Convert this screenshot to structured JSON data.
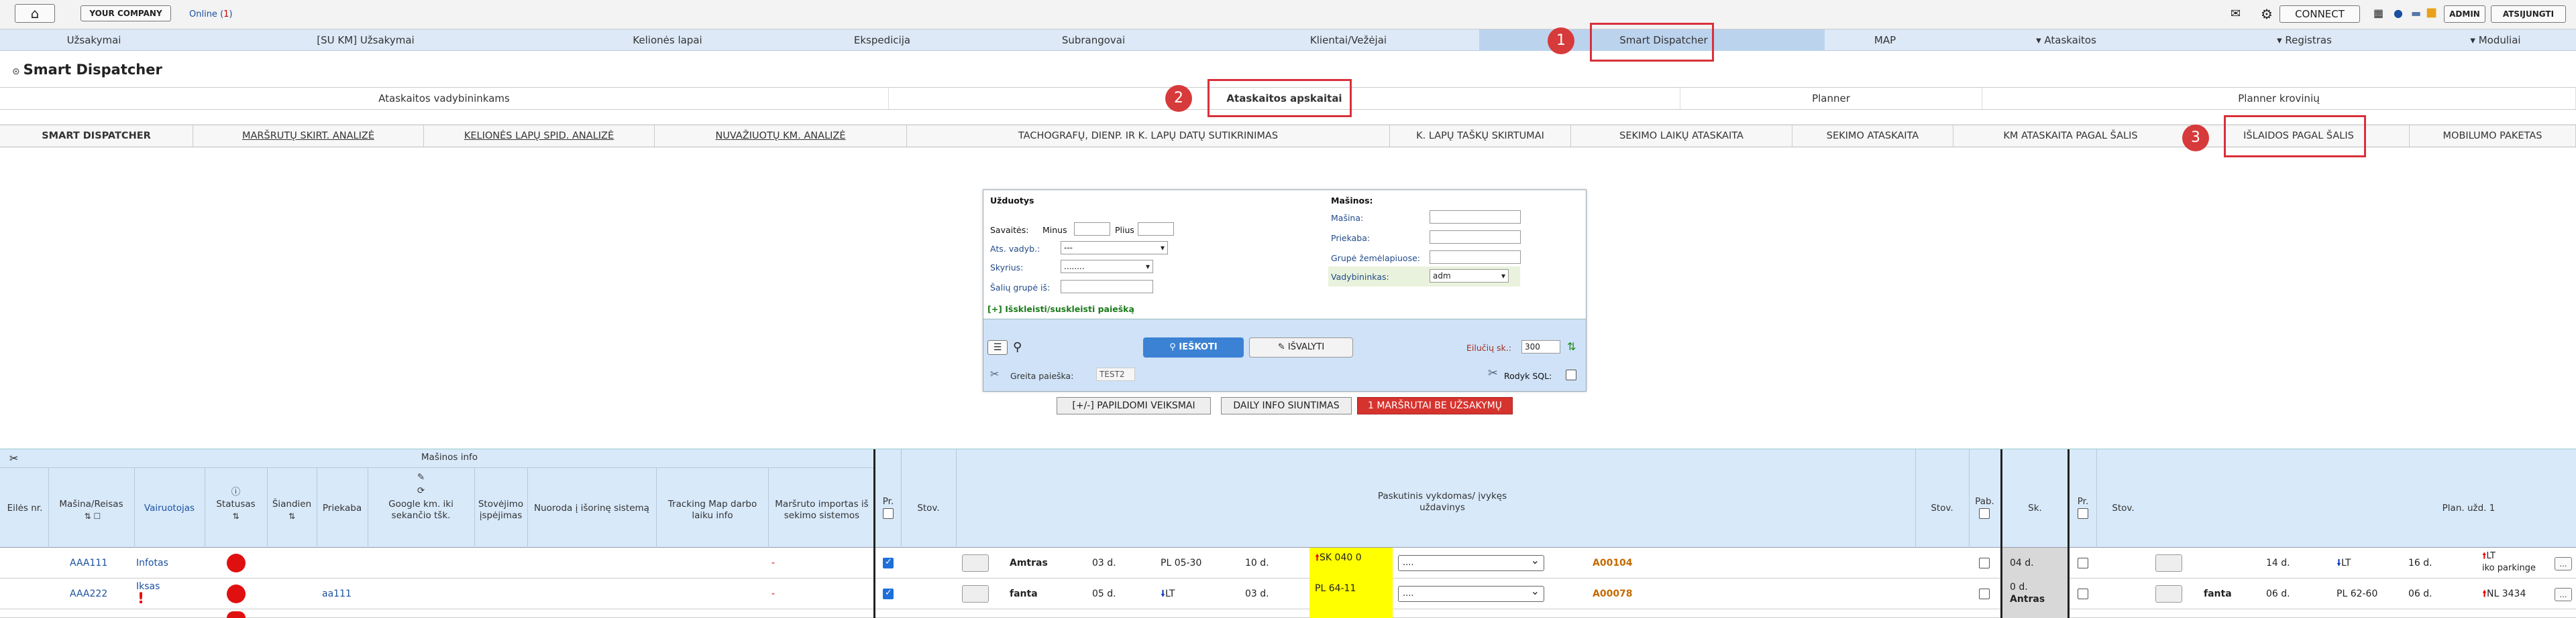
{
  "topbar": {
    "company": "YOUR COMPANY",
    "online_label": "Online",
    "online_count": "1",
    "connect": "CONNECT",
    "admin": "ADMIN",
    "logout": "ATSIJUNGTI"
  },
  "nav": {
    "items": [
      "Užsakymai",
      "[SU KM] Užsakymai",
      "Kelionės lapai",
      "Ekspedicija",
      "Subrangovai",
      "Klientai/Vežėjai",
      "Smart Dispatcher",
      "MAP",
      "▾ Ataskaitos",
      "▾ Registras",
      "▾ Moduliai"
    ]
  },
  "page": {
    "title": "Smart Dispatcher"
  },
  "tabs1": [
    "Ataskaitos vadybininkams",
    "Ataskaitos apskaitai",
    "Planner",
    "Planner krovinių"
  ],
  "tabs2": [
    "Smart Dispatcher",
    "Maršrutų skirt. analizė",
    "Kelionės lapų spid. analizė",
    "Nuvažiuotų km. analizė",
    "Tachografų, dienp. ir k. lapų datų sutikrinimas",
    "K. lapų taškų skirtumai",
    "Sekimo laikų ataskaita",
    "Sekimo ataskaita",
    "KM ataskaita pagal šalis",
    "Išlaidos pagal šalis",
    "Mobilumo paketas"
  ],
  "badges": [
    "1",
    "2",
    "3"
  ],
  "filter": {
    "section_left": "Užduotys",
    "savaites": "Savaitės:",
    "minus": "Minus",
    "plius": "Plius",
    "ats_vadyb": "Ats. vadyb.:",
    "ats_vadyb_value": "---",
    "skyrius": "Skyrius:",
    "skyrius_value": "........",
    "saliu_grupe": "Šalių grupė iš:",
    "expand": "[+] Išskleisti/suskleisti paiešką",
    "section_right": "Mašinos:",
    "masina": "Mašina:",
    "priekaba": "Priekaba:",
    "grupe": "Grupė žemėlapiuose:",
    "vadybininkas": "Vadybininkas:",
    "vadybininkas_value": "adm",
    "search_btn": "IEŠKOTI",
    "clear_btn": "IŠVALYTI",
    "rows_label": "Eilučių sk.:",
    "rows_value": "300",
    "quick_search_label": "Greita paieška:",
    "quick_search_value": "TEST2",
    "show_sql": "Rodyk SQL:"
  },
  "actions": [
    "[+/-] PAPILDOMI VEIKSMAI",
    "DAILY INFO SIUNTIMAS",
    "1 MARŠRUTAI BE UŽSAKYMŲ"
  ],
  "table": {
    "group_header": "Mašinos info",
    "headers": [
      "Eilės nr.",
      "Mašina/Reisas",
      "Vairuotojas",
      "Statusas",
      "Šiandien",
      "Priekaba",
      "Google km. iki sekančio tšk.",
      "Stovėjimo įspėjimas",
      "Nuoroda į išorinę sistemą",
      "Tracking Map darbo laiku info",
      "Maršruto importas iš sekimo sistemos",
      "Pr.",
      "Stov.",
      "Paskutinis vykdomas/ įvykęs uždavinys",
      "Stov.",
      "Pab.",
      "Sk.",
      "Pr.",
      "Stov.",
      "Plan. užd. 1"
    ],
    "rows": [
      {
        "masina": "AAA111",
        "vairuotojas": "Infotas",
        "priekaba": "",
        "import": "-",
        "task_company": "Amtras",
        "d1": "03 d.",
        "pl": "PL 05-30",
        "d2": "10 d.",
        "yellow": "SK 040 0",
        "dd": "....",
        "order": "A00104",
        "sk": "04 d.",
        "d3": "14 d.",
        "lt": "LT",
        "d4": "16 d.",
        "lt2": "LT",
        "lt2b": "iko parkinge"
      },
      {
        "masina": "AAA222",
        "vairuotojas": "Iksas",
        "priekaba": "aa111",
        "import": "-",
        "task_company": "fanta",
        "d1": "05 d.",
        "pl": "LT",
        "d2": "03 d.",
        "yellow": "PL 64-11",
        "dd": "....",
        "order": "A00078",
        "sk": "0 d.",
        "sk2": "Antras",
        "company2": "fanta",
        "d3": "06 d.",
        "pl2": "PL 62-60",
        "d4": "06 d.",
        "lt2": "NL 3434"
      }
    ]
  }
}
